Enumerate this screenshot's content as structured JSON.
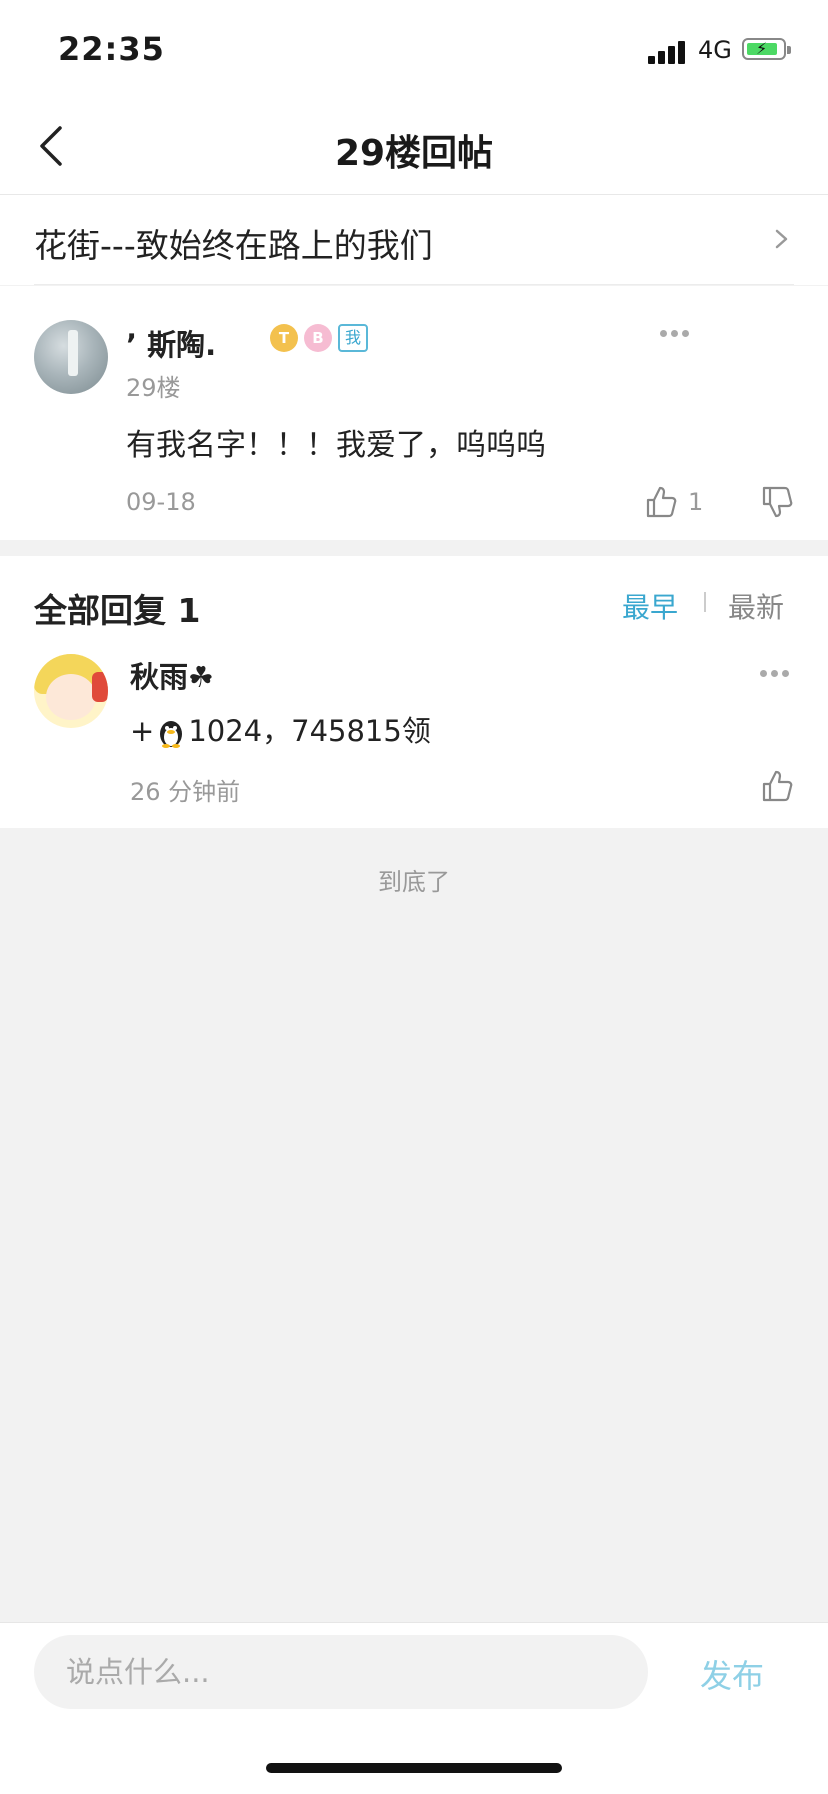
{
  "status_bar": {
    "time": "22:35",
    "network": "4G"
  },
  "nav": {
    "title": "29楼回帖"
  },
  "thread": {
    "title": "花街---致始终在路上的我们"
  },
  "post": {
    "username": "’ 斯陶.",
    "badges": {
      "t": "T",
      "b": "B",
      "me": "我"
    },
    "floor": "29楼",
    "content": "有我名字！！！我爱了，呜呜呜",
    "date": "09-18",
    "like_count": "1"
  },
  "replies": {
    "title": "全部回复 1",
    "sort_earliest": "最早",
    "sort_latest": "最新",
    "items": [
      {
        "name": "秋雨☘",
        "content_prefix": "+",
        "content_suffix": "1024，745815领",
        "time": "26 分钟前"
      }
    ]
  },
  "end_text": "到底了",
  "composer": {
    "placeholder": "说点什么...",
    "publish_label": "发布"
  },
  "colors": {
    "accent": "#3aa7cf",
    "publish": "#8ed0e6",
    "background": "#f2f2f2"
  },
  "icons": [
    "back-icon",
    "chevron-right-icon",
    "more-icon",
    "thumbs-up-icon",
    "thumbs-down-icon",
    "penguin-icon"
  ]
}
